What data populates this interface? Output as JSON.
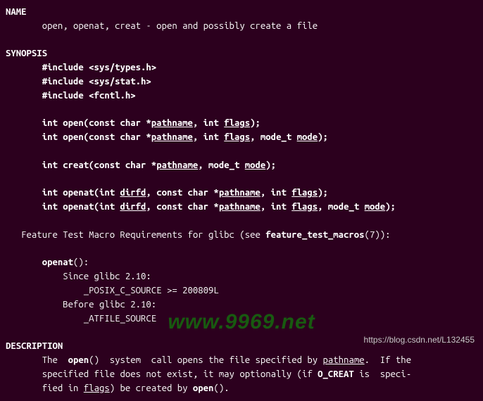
{
  "name": {
    "heading": "NAME",
    "line": "open, openat, creat - open and possibly create a file"
  },
  "synopsis": {
    "heading": "SYNOPSIS",
    "include1": "#include <sys/types.h>",
    "include2": "#include <sys/stat.h>",
    "include3": "#include <fcntl.h>",
    "fn_open1_pre": "int open(const char *",
    "fn_open1_path": "pathname",
    "fn_open1_mid": ", int ",
    "fn_open1_flags": "flags",
    "fn_open1_end": ");",
    "fn_open2_pre": "int open(const char *",
    "fn_open2_path": "pathname",
    "fn_open2_mid1": ", int ",
    "fn_open2_flags": "flags",
    "fn_open2_mid2": ", mode_t ",
    "fn_open2_mode": "mode",
    "fn_open2_end": ");",
    "fn_creat_pre": "int creat(const char *",
    "fn_creat_path": "pathname",
    "fn_creat_mid": ", mode_t ",
    "fn_creat_mode": "mode",
    "fn_creat_end": ");",
    "fn_openat1_pre": "int openat(int ",
    "fn_openat1_dirfd": "dirfd",
    "fn_openat1_mid1": ", const char *",
    "fn_openat1_path": "pathname",
    "fn_openat1_mid2": ", int ",
    "fn_openat1_flags": "flags",
    "fn_openat1_end": ");",
    "fn_openat2_pre": "int openat(int ",
    "fn_openat2_dirfd": "dirfd",
    "fn_openat2_mid1": ", const char *",
    "fn_openat2_path": "pathname",
    "fn_openat2_mid2": ", int ",
    "fn_openat2_flags": "flags",
    "fn_openat2_mid3": ", mode_t ",
    "fn_openat2_mode": "mode",
    "fn_openat2_end": ");",
    "ftm_intro_pre": "Feature Test Macro Requirements for glibc (see ",
    "ftm_ref": "feature_test_macros",
    "ftm_intro_post": "(7)):",
    "ftm_fn": "openat",
    "ftm_fn_post": "():",
    "ftm_since": "Since glibc 2.10:",
    "ftm_posix": "_POSIX_C_SOURCE >= 200809L",
    "ftm_before": "Before glibc 2.10:",
    "ftm_atfile": "_ATFILE_SOURCE"
  },
  "description": {
    "heading": "DESCRIPTION",
    "l1_a": "The  ",
    "l1_open": "open",
    "l1_b": "()  system  call opens the file specified by ",
    "l1_path": "pathname",
    "l1_c": ".  If the",
    "l2_a": "specified file does not exist, it may optionally (if ",
    "l2_ocreat": "O_CREAT",
    "l2_b": " is  speci‐",
    "l3_a": "fied in ",
    "l3_flags": "flags",
    "l3_b": ") be created by ",
    "l3_open": "open",
    "l3_c": "()."
  },
  "watermark": "www.9969.net",
  "source_url": "https://blog.csdn.net/L132455"
}
